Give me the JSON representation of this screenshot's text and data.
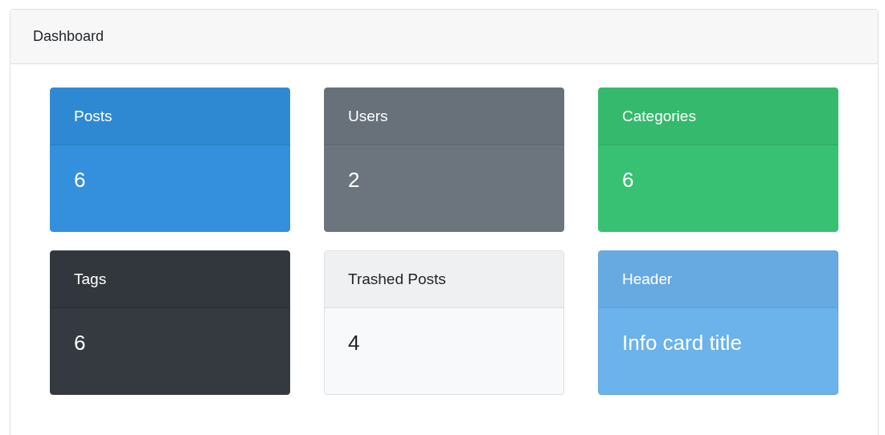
{
  "panel": {
    "title": "Dashboard"
  },
  "cards": [
    {
      "kind": "primary",
      "header": "Posts",
      "value": "6"
    },
    {
      "kind": "secondary",
      "header": "Users",
      "value": "2"
    },
    {
      "kind": "success",
      "header": "Categories",
      "value": "6"
    },
    {
      "kind": "dark",
      "header": "Tags",
      "value": "6"
    },
    {
      "kind": "light",
      "header": "Trashed Posts",
      "value": "4"
    },
    {
      "kind": "info",
      "header": "Header",
      "value": "Info card title"
    }
  ]
}
